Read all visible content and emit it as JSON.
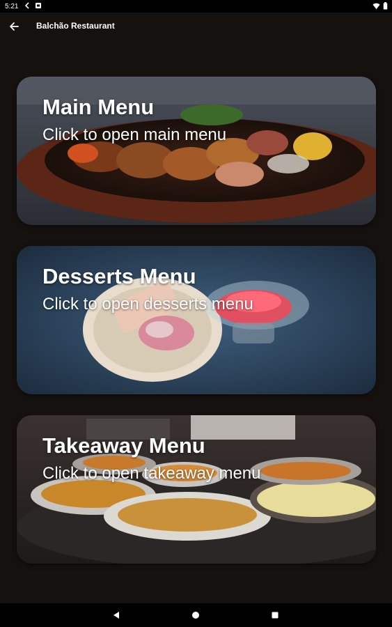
{
  "status_bar": {
    "time": "5:21",
    "icons": [
      "notification-icon",
      "media-icon",
      "wifi-icon",
      "battery-icon"
    ]
  },
  "app_bar": {
    "back_icon": "arrow-left-icon",
    "title": "Balchão Restaurant"
  },
  "cards": [
    {
      "title": "Main Menu",
      "subtitle": "Click to open main menu",
      "image": "sizzling-kebab-platter"
    },
    {
      "title": "Desserts Menu",
      "subtitle": "Click to open desserts menu",
      "image": "dessert-plate-and-glass"
    },
    {
      "title": "Takeaway Menu",
      "subtitle": "Click to open takeaway menu",
      "image": "curry-buffet-dishes"
    }
  ],
  "nav_bar": {
    "icons": [
      "nav-back-icon",
      "nav-home-icon",
      "nav-recents-icon"
    ]
  },
  "colors": {
    "background": "#15110f",
    "system_bars": "#000000",
    "text": "#ffffff"
  }
}
